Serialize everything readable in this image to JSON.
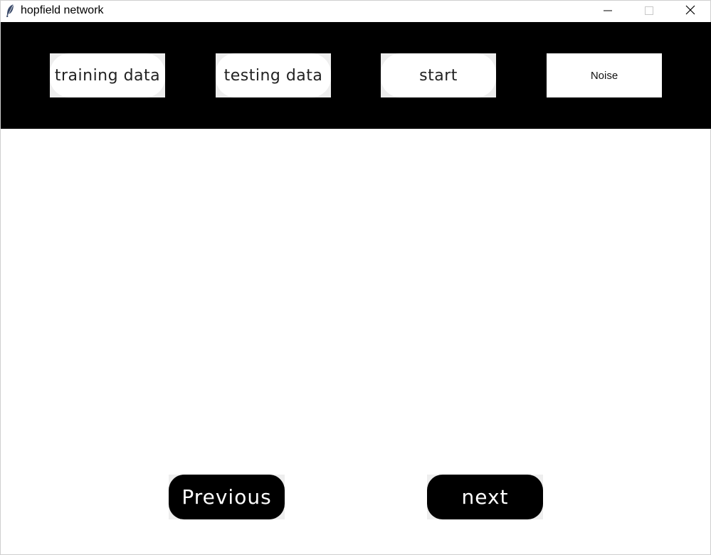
{
  "window": {
    "title": "hopfield network",
    "icon": "feather-icon",
    "controls": [
      "minimize-icon",
      "maximize-icon",
      "close-icon"
    ]
  },
  "toolbar": {
    "background": "#000000",
    "buttons": {
      "training": "training data",
      "testing": "testing data",
      "start": "start",
      "noise": "Noise"
    }
  },
  "navigation": {
    "previous": "Previous",
    "next": "next",
    "button_color": "#000000",
    "text_color": "#ffffff"
  }
}
